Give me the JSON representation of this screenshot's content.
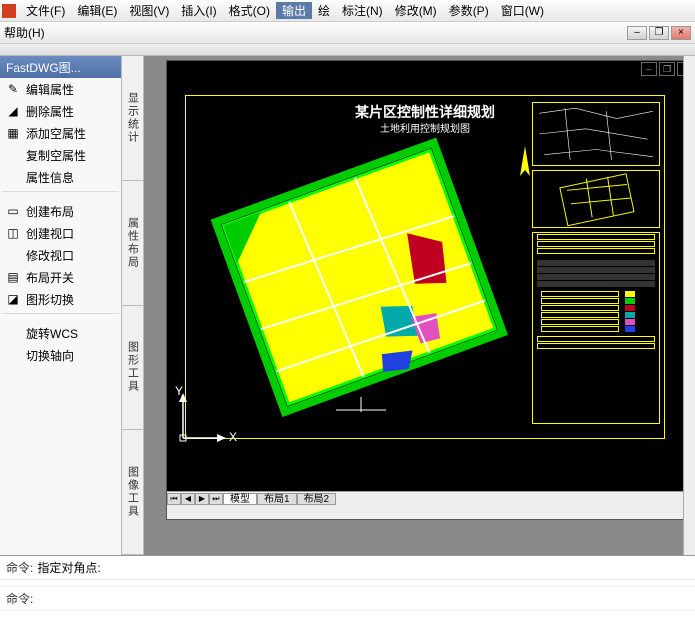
{
  "menu": {
    "items": [
      "文件(F)",
      "编辑(E)",
      "视图(V)",
      "插入(I)",
      "格式(O)",
      "输出",
      "绘",
      "标注(N)",
      "修改(M)",
      "参数(P)",
      "窗口(W)"
    ],
    "help": "帮助(H)"
  },
  "leftPanel": {
    "title": "FastDWG图...",
    "items": [
      {
        "icon": "pencil",
        "label": "编辑属性"
      },
      {
        "icon": "eraser",
        "label": "删除属性"
      },
      {
        "icon": "grid",
        "label": "添加空属性"
      },
      {
        "icon": "none",
        "label": "复制空属性"
      },
      {
        "icon": "none",
        "label": "属性信息"
      },
      {
        "sep": true
      },
      {
        "icon": "layout",
        "label": "创建布局"
      },
      {
        "icon": "viewport",
        "label": "创建视口"
      },
      {
        "icon": "none",
        "label": "修改视口"
      },
      {
        "icon": "layout2",
        "label": "布局开关"
      },
      {
        "icon": "swap",
        "label": "图形切换"
      },
      {
        "sep": true
      },
      {
        "icon": "none",
        "label": "旋转WCS"
      },
      {
        "icon": "none",
        "label": "切换轴向"
      }
    ]
  },
  "vtabs": [
    "显示统计",
    "属性布局",
    "图形工具",
    "图像工具"
  ],
  "drawing": {
    "title": "某片区控制性详细规划",
    "subtitle": "土地利用控制规划图"
  },
  "tabs": {
    "items": [
      "模型",
      "布局1",
      "布局2"
    ],
    "active": 0
  },
  "ucs": {
    "x": "X",
    "y": "Y"
  },
  "cmd": {
    "prompt": "命令:",
    "line1": "指定对角点:",
    "line2": ""
  },
  "winbtns": {
    "min": "–",
    "max": "❐",
    "close": "×"
  },
  "navbtns": {
    "first": "⏮",
    "prev": "◀",
    "next": "▶",
    "last": "⏭"
  }
}
